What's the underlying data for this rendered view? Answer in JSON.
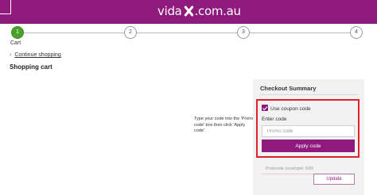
{
  "header": {
    "logo_prefix": "vida",
    "logo_suffix": ".com.au",
    "brand_color": "#8e1a7e"
  },
  "stepper": {
    "steps": [
      {
        "number": "1",
        "label": "Cart",
        "active": true
      },
      {
        "number": "2",
        "label": ""
      },
      {
        "number": "3",
        "label": ""
      },
      {
        "number": "4",
        "label": ""
      }
    ],
    "active_color": "#4aa02c"
  },
  "nav": {
    "continue_icon": "chevron-left-icon",
    "continue_glyph": "‹",
    "continue_label": "Continue shopping"
  },
  "main": {
    "title": "Shopping cart",
    "hint": "Type your code into the 'Promo code' box then click 'Apply code'."
  },
  "summary": {
    "title": "Checkout Summary",
    "coupon_checkbox_label": "Use coupon code",
    "coupon_checked": true,
    "enter_code_label": "Enter code",
    "promo_placeholder": "Promo code",
    "apply_label": "Apply code",
    "postcode_placeholder": "Postcode (example: 5000)",
    "update_label": "Update",
    "highlight_color": "#e0202a"
  }
}
